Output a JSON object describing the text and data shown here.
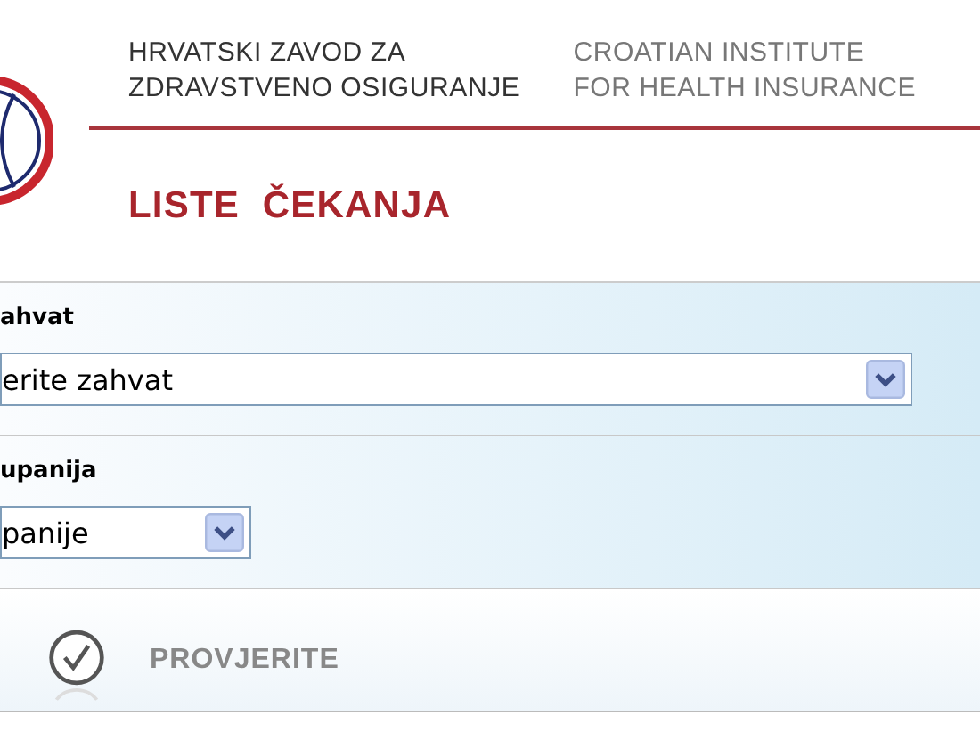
{
  "header": {
    "name_hr": [
      "HRVATSKI ZAVOD ZA",
      "ZDRAVSTVENO OSIGURANJE"
    ],
    "name_en": [
      "CROATIAN INSTITUTE",
      "FOR HEALTH INSURANCE"
    ]
  },
  "page_title": "LISTE  ČEKANJA",
  "fields": [
    {
      "label": "ahvat",
      "value": "erite zahvat",
      "kind": "wide"
    },
    {
      "label": "upanija",
      "value": "panije",
      "kind": "narrow"
    }
  ],
  "submit": {
    "label": "PROVJERITE"
  }
}
